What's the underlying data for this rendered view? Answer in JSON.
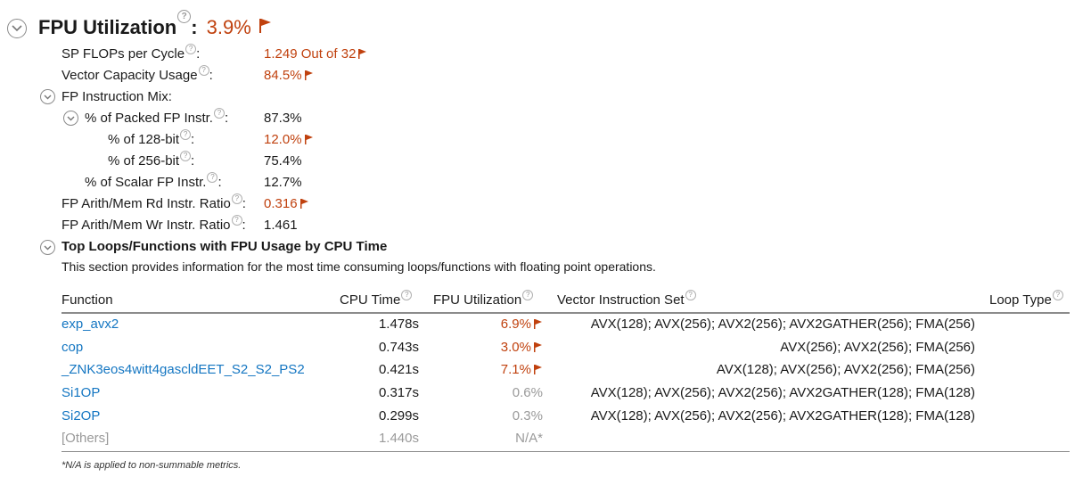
{
  "header": {
    "title": "FPU Utilization",
    "colon": ":",
    "value": "3.9%"
  },
  "metrics": [
    {
      "label": "SP FLOPs per Cycle",
      "value": "1.249 Out of 32",
      "flagged": true
    },
    {
      "label": "Vector Capacity Usage",
      "value": "84.5%",
      "flagged": true
    }
  ],
  "mix": {
    "label": "FP Instruction Mix:",
    "packed": {
      "label": "% of Packed FP Instr.",
      "value": "87.3%"
    },
    "bit128": {
      "label": "% of 128-bit",
      "value": "12.0%",
      "flagged": true
    },
    "bit256": {
      "label": "% of 256-bit",
      "value": "75.4%"
    },
    "scalar": {
      "label": "% of Scalar FP Instr.",
      "value": "12.7%"
    }
  },
  "ratios": [
    {
      "label": "FP Arith/Mem Rd Instr. Ratio",
      "value": "0.316",
      "flagged": true
    },
    {
      "label": "FP Arith/Mem Wr Instr. Ratio",
      "value": "1.461",
      "flagged": false
    }
  ],
  "section": {
    "title": "Top Loops/Functions with FPU Usage by CPU Time",
    "description": "This section provides information for the most time consuming loops/functions with floating point operations."
  },
  "table": {
    "columns": {
      "function": "Function",
      "cpu_time": "CPU Time",
      "fpu": "FPU Utilization",
      "vector": "Vector Instruction Set",
      "loop_type": "Loop Type"
    },
    "rows": [
      {
        "function": "exp_avx2",
        "cpu_time": "1.478s",
        "fpu": "6.9%",
        "flagged": true,
        "vector": "AVX(128); AVX(256); AVX2(256); AVX2GATHER(256); FMA(256)",
        "loop_type": ""
      },
      {
        "function": "cop",
        "cpu_time": "0.743s",
        "fpu": "3.0%",
        "flagged": true,
        "vector": "AVX(256); AVX2(256); FMA(256)",
        "loop_type": ""
      },
      {
        "function": "_ZNK3eos4witt4gascldEET_S2_S2_PS2",
        "cpu_time": "0.421s",
        "fpu": "7.1%",
        "flagged": true,
        "vector": "AVX(128); AVX(256); AVX2(256); FMA(256)",
        "loop_type": ""
      },
      {
        "function": "Si1OP",
        "cpu_time": "0.317s",
        "fpu": "0.6%",
        "flagged": false,
        "vector": "AVX(128); AVX(256); AVX2(256); AVX2GATHER(128); FMA(128)",
        "loop_type": ""
      },
      {
        "function": "Si2OP",
        "cpu_time": "0.299s",
        "fpu": "0.3%",
        "flagged": false,
        "vector": "AVX(128); AVX(256); AVX2(256); AVX2GATHER(128); FMA(128)",
        "loop_type": ""
      },
      {
        "function": "[Others]",
        "cpu_time": "1.440s",
        "fpu": "N/A*",
        "flagged": false,
        "vector": "",
        "loop_type": ""
      }
    ],
    "footnote": "*N/A is applied to non-summable metrics."
  },
  "colors": {
    "warning": "#c0410e",
    "link": "#1476c2",
    "muted": "#9a9a9a"
  },
  "icons": {
    "collapse": "chevron-up-circle-icon",
    "help": "help-circle-icon",
    "flag": "flag-icon"
  }
}
